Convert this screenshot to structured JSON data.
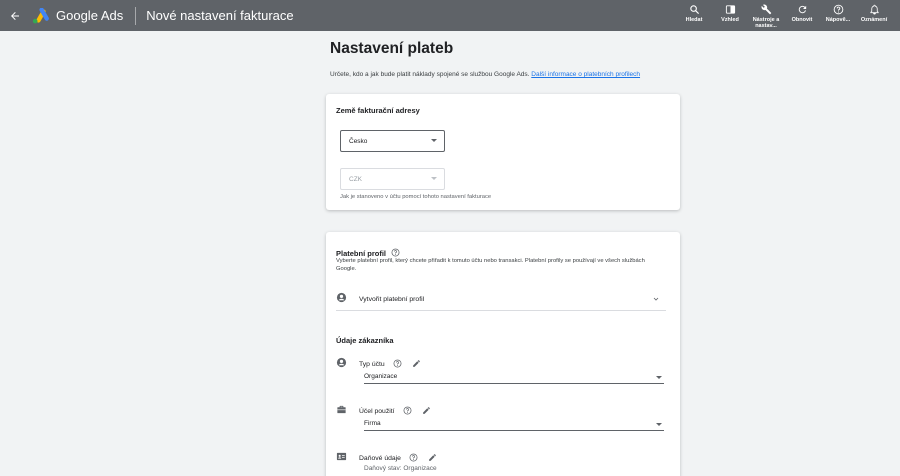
{
  "topbar": {
    "brand": "Google Ads",
    "page_name": "Nové nastavení fakturace",
    "tools": [
      {
        "label": "Hledat",
        "icon": "search-icon"
      },
      {
        "label": "Vzhled",
        "icon": "appearance-icon"
      },
      {
        "label": "Nástroje a nastav...",
        "icon": "wrench-icon"
      },
      {
        "label": "Obnovit",
        "icon": "refresh-icon"
      },
      {
        "label": "Nápově...",
        "icon": "help-icon"
      },
      {
        "label": "Oznámení",
        "icon": "bell-icon"
      }
    ]
  },
  "page": {
    "title": "Nastavení plateb",
    "intro_text": "Určete, kdo a jak bude platit náklady spojené se službou Google Ads. ",
    "intro_link": "Další informace o platebních profilech"
  },
  "billing_country": {
    "heading": "Země fakturační adresy",
    "country_value": "Česko",
    "currency_value": "CZK",
    "currency_note": "Jak je stanoveno v účtu pomocí tohoto nastavení fakturace"
  },
  "payments_profile": {
    "heading": "Platební profil",
    "description": "Vyberte platební profil, který chcete přiřadit k tomuto účtu nebo transakci. Platební profily se používají ve všech službách Google.",
    "create_label": "Vytvořit platební profil"
  },
  "customer_info": {
    "heading": "Údaje zákazníka",
    "account_type_label": "Typ účtu",
    "account_type_value": "Organizace",
    "usage_label": "Účel použití",
    "usage_value": "Firma",
    "tax_label": "Daňové údaje",
    "tax_status": "Daňový stav: Organizace"
  },
  "colors": {
    "topbar": "#5f6368",
    "link": "#1a73e8",
    "background": "#f1f3f4"
  }
}
